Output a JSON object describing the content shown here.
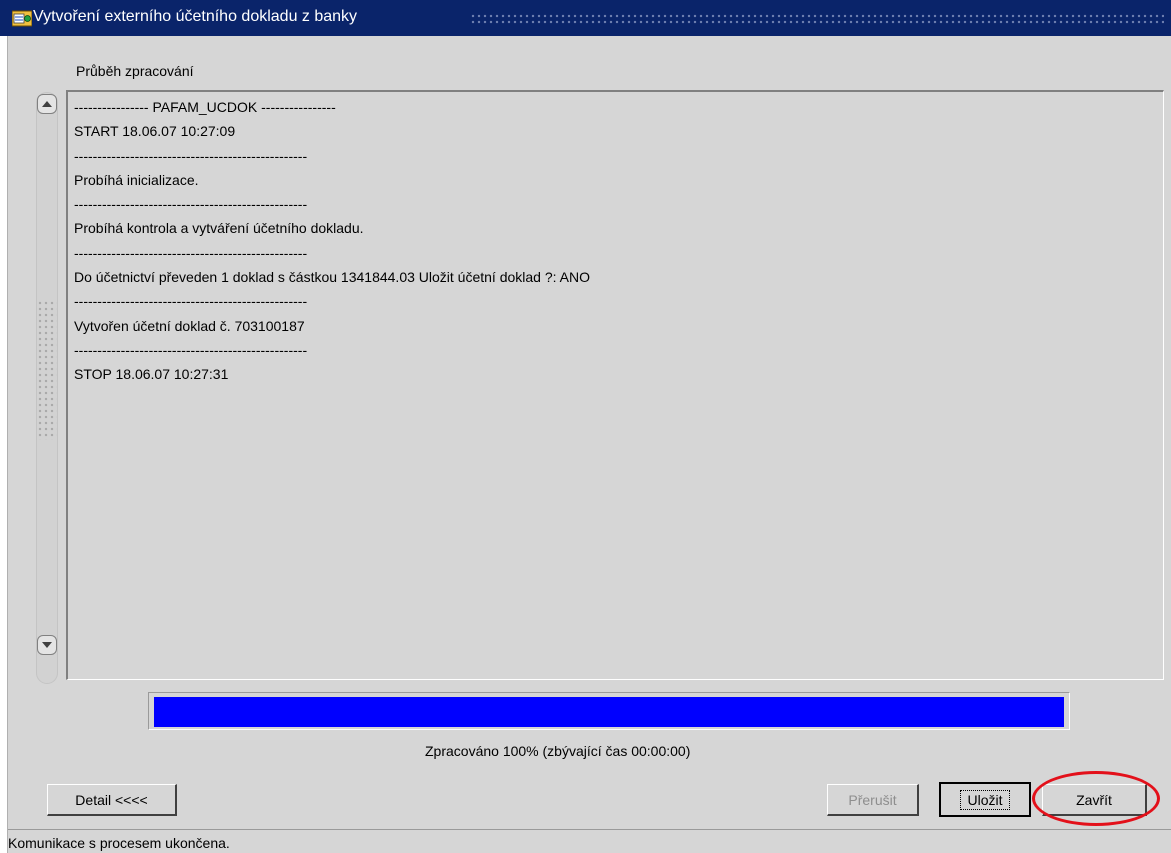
{
  "window": {
    "title": "Vytvoření externího účetního dokladu z banky",
    "icon": "app-icon"
  },
  "section": {
    "label": "Průběh zpracování"
  },
  "log": {
    "lines": [
      "---------------- PAFAM_UCDOK ----------------",
      "START 18.06.07 10:27:09",
      "--------------------------------------------------",
      "Probíhá inicializace.",
      "--------------------------------------------------",
      "Probíhá kontrola a vytváření účetního dokladu.",
      "--------------------------------------------------",
      "Do účetnictví  převeden 1 doklad s částkou 1341844.03 Uložit účetní doklad ?: ANO",
      "--------------------------------------------------",
      "Vytvořen účetní doklad č. 703100187",
      "--------------------------------------------------",
      "STOP 18.06.07 10:27:31"
    ]
  },
  "progress": {
    "percent": 100,
    "fill_color": "#0000ff",
    "text": "Zpracováno 100% (zbývající čas 00:00:00)"
  },
  "buttons": {
    "detail": "Detail  <<<<",
    "prerusit": "Přerušit",
    "ulozit": "Uložit",
    "zavrit": "Zavřít"
  },
  "status": {
    "text": "Komunikace s procesem ukončena."
  },
  "colors": {
    "titlebar": "#0a246a",
    "highlight": "#e3101a"
  }
}
